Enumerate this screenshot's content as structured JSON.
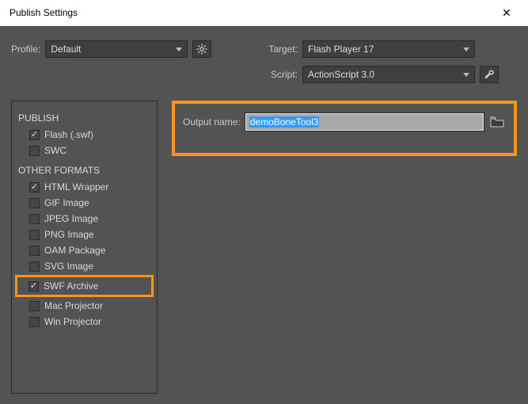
{
  "window": {
    "title": "Publish Settings"
  },
  "profile": {
    "label": "Profile:",
    "value": "Default"
  },
  "target": {
    "label": "Target:",
    "value": "Flash Player 17"
  },
  "script": {
    "label": "Script:",
    "value": "ActionScript 3.0"
  },
  "output": {
    "label": "Output name:",
    "value": "demoBoneTool3"
  },
  "sidebar": {
    "publish_header": "PUBLISH",
    "other_header": "OTHER FORMATS",
    "items": [
      {
        "label": "Flash (.swf)",
        "checked": true
      },
      {
        "label": "SWC",
        "checked": false
      }
    ],
    "other_items": [
      {
        "label": "HTML Wrapper",
        "checked": true
      },
      {
        "label": "GIF Image",
        "checked": false
      },
      {
        "label": "JPEG Image",
        "checked": false
      },
      {
        "label": "PNG Image",
        "checked": false
      },
      {
        "label": "OAM Package",
        "checked": false
      },
      {
        "label": "SVG Image",
        "checked": false
      },
      {
        "label": "SWF Archive",
        "checked": true
      },
      {
        "label": "Mac Projector",
        "checked": false
      },
      {
        "label": "Win Projector",
        "checked": false
      }
    ]
  }
}
